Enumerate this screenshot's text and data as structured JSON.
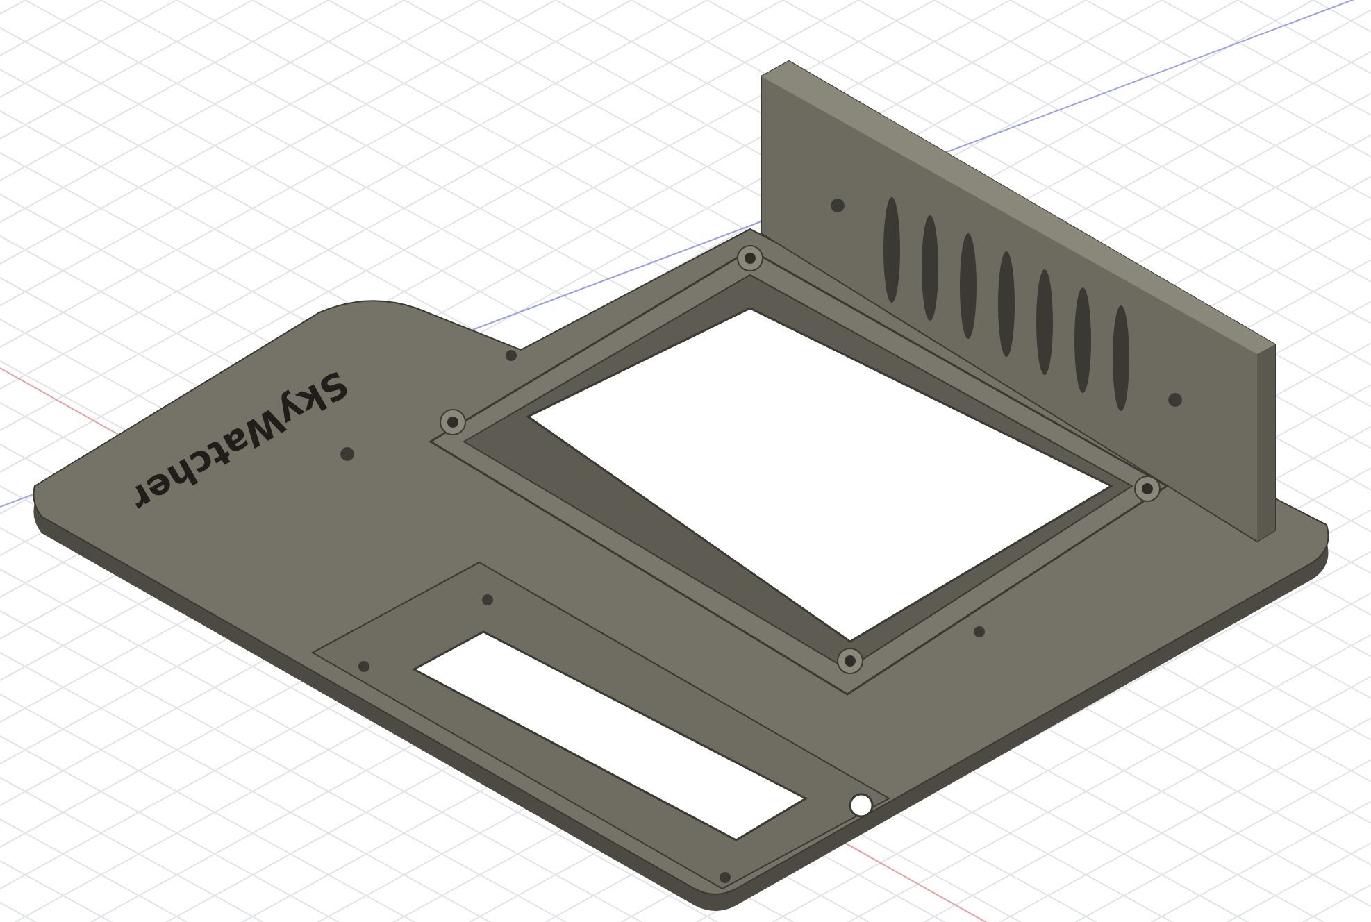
{
  "viewport": {
    "engraving": "SkyWatcher"
  }
}
